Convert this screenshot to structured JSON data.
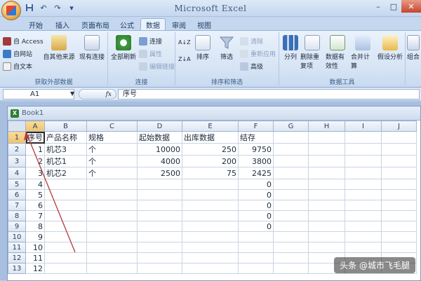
{
  "window": {
    "title": "Microsoft Excel",
    "minimize_label": "–",
    "maximize_label": "□",
    "close_label": "✕"
  },
  "qat": {
    "save_icon": "save-icon",
    "undo_label": "↶",
    "redo_label": "↷",
    "more_label": "▾"
  },
  "tabs": [
    {
      "label": "开始"
    },
    {
      "label": "插入"
    },
    {
      "label": "页面布局"
    },
    {
      "label": "公式"
    },
    {
      "label": "数据",
      "active": true
    },
    {
      "label": "审阅"
    },
    {
      "label": "视图"
    }
  ],
  "ribbon": {
    "external_data": {
      "label": "获取外部数据",
      "access": "自 Access",
      "web": "自网站",
      "text": "自文本",
      "other": "自其他来源",
      "existing": "现有连接"
    },
    "connections": {
      "label": "连接",
      "refresh_all": "全部刷新",
      "connections": "连接",
      "properties": "属性",
      "edit_links": "编辑链接"
    },
    "sort_filter": {
      "label": "排序和筛选",
      "sort_az": "A↓Z",
      "sort_za": "Z↓A",
      "sort": "排序",
      "filter": "筛选",
      "clear": "清除",
      "reapply": "重新应用",
      "advanced": "高级"
    },
    "data_tools": {
      "label": "数据工具",
      "text_to_columns": "分列",
      "remove_dup": "删除重复项",
      "validation": "数据有效性",
      "consolidate": "合并计算",
      "what_if": "假设分析"
    },
    "outline": {
      "group": "组合"
    }
  },
  "formula_bar": {
    "name_box": "A1",
    "fx": "fx",
    "content": "序号"
  },
  "workbook": {
    "title": "Book1",
    "columns": [
      "A",
      "B",
      "C",
      "D",
      "E",
      "F",
      "G",
      "H",
      "I",
      "J"
    ],
    "rows": [
      {
        "n": "1",
        "cells": [
          "序号",
          "产品名称",
          "规格",
          "起始数据",
          "出库数据",
          "结存",
          "",
          "",
          "",
          ""
        ]
      },
      {
        "n": "2",
        "cells": [
          "1",
          "机芯3",
          "个",
          "10000",
          "250",
          "9750",
          "",
          "",
          "",
          ""
        ]
      },
      {
        "n": "3",
        "cells": [
          "2",
          "机芯1",
          "个",
          "4000",
          "200",
          "3800",
          "",
          "",
          "",
          ""
        ]
      },
      {
        "n": "4",
        "cells": [
          "3",
          "机芯2",
          "个",
          "2500",
          "75",
          "2425",
          "",
          "",
          "",
          ""
        ]
      },
      {
        "n": "5",
        "cells": [
          "4",
          "",
          "",
          "",
          "",
          "0",
          "",
          "",
          "",
          ""
        ]
      },
      {
        "n": "6",
        "cells": [
          "5",
          "",
          "",
          "",
          "",
          "0",
          "",
          "",
          "",
          ""
        ]
      },
      {
        "n": "7",
        "cells": [
          "6",
          "",
          "",
          "",
          "",
          "0",
          "",
          "",
          "",
          ""
        ]
      },
      {
        "n": "8",
        "cells": [
          "7",
          "",
          "",
          "",
          "",
          "0",
          "",
          "",
          "",
          ""
        ]
      },
      {
        "n": "9",
        "cells": [
          "8",
          "",
          "",
          "",
          "",
          "0",
          "",
          "",
          "",
          ""
        ]
      },
      {
        "n": "10",
        "cells": [
          "9",
          "",
          "",
          "",
          "",
          "",
          "",
          "",
          "",
          ""
        ]
      },
      {
        "n": "11",
        "cells": [
          "10",
          "",
          "",
          "",
          "",
          "",
          "",
          "",
          "",
          ""
        ]
      },
      {
        "n": "12",
        "cells": [
          "11",
          "",
          "",
          "",
          "",
          "",
          "",
          "",
          "",
          ""
        ]
      },
      {
        "n": "13",
        "cells": [
          "12",
          "",
          "",
          "",
          "",
          "",
          "",
          "",
          "",
          ""
        ]
      }
    ]
  },
  "watermark": "头条 @城市飞毛腿"
}
